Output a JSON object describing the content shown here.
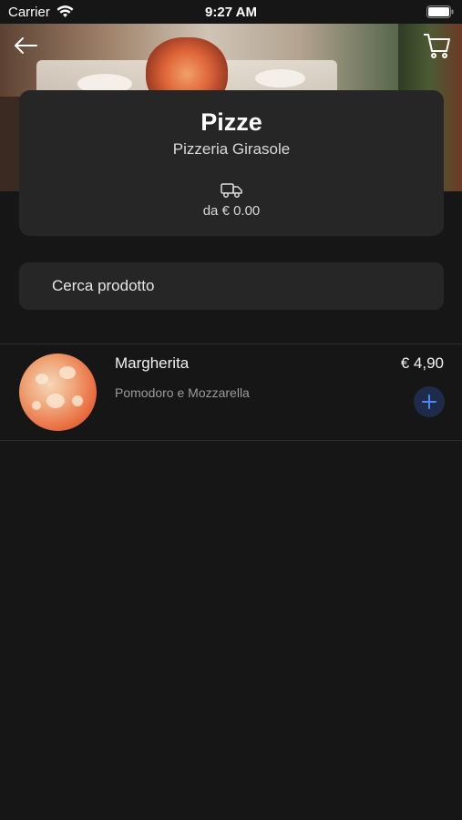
{
  "status_bar": {
    "carrier": "Carrier",
    "time": "9:27 AM"
  },
  "header": {
    "back_icon": "arrow-left-icon",
    "cart_icon": "cart-icon"
  },
  "category": {
    "title": "Pizze",
    "restaurant": "Pizzeria Girasole",
    "delivery_icon": "truck-icon",
    "delivery_text": "da € 0.00"
  },
  "search": {
    "placeholder": "Cerca prodotto"
  },
  "products": [
    {
      "name": "Margherita",
      "description": "Pomodoro e Mozzarella",
      "price": "€ 4,90",
      "add_icon": "plus-icon"
    }
  ],
  "colors": {
    "background": "#161616",
    "card": "#262626",
    "accent": "#3b6fd9",
    "accent_bg": "#1f2b4a"
  }
}
